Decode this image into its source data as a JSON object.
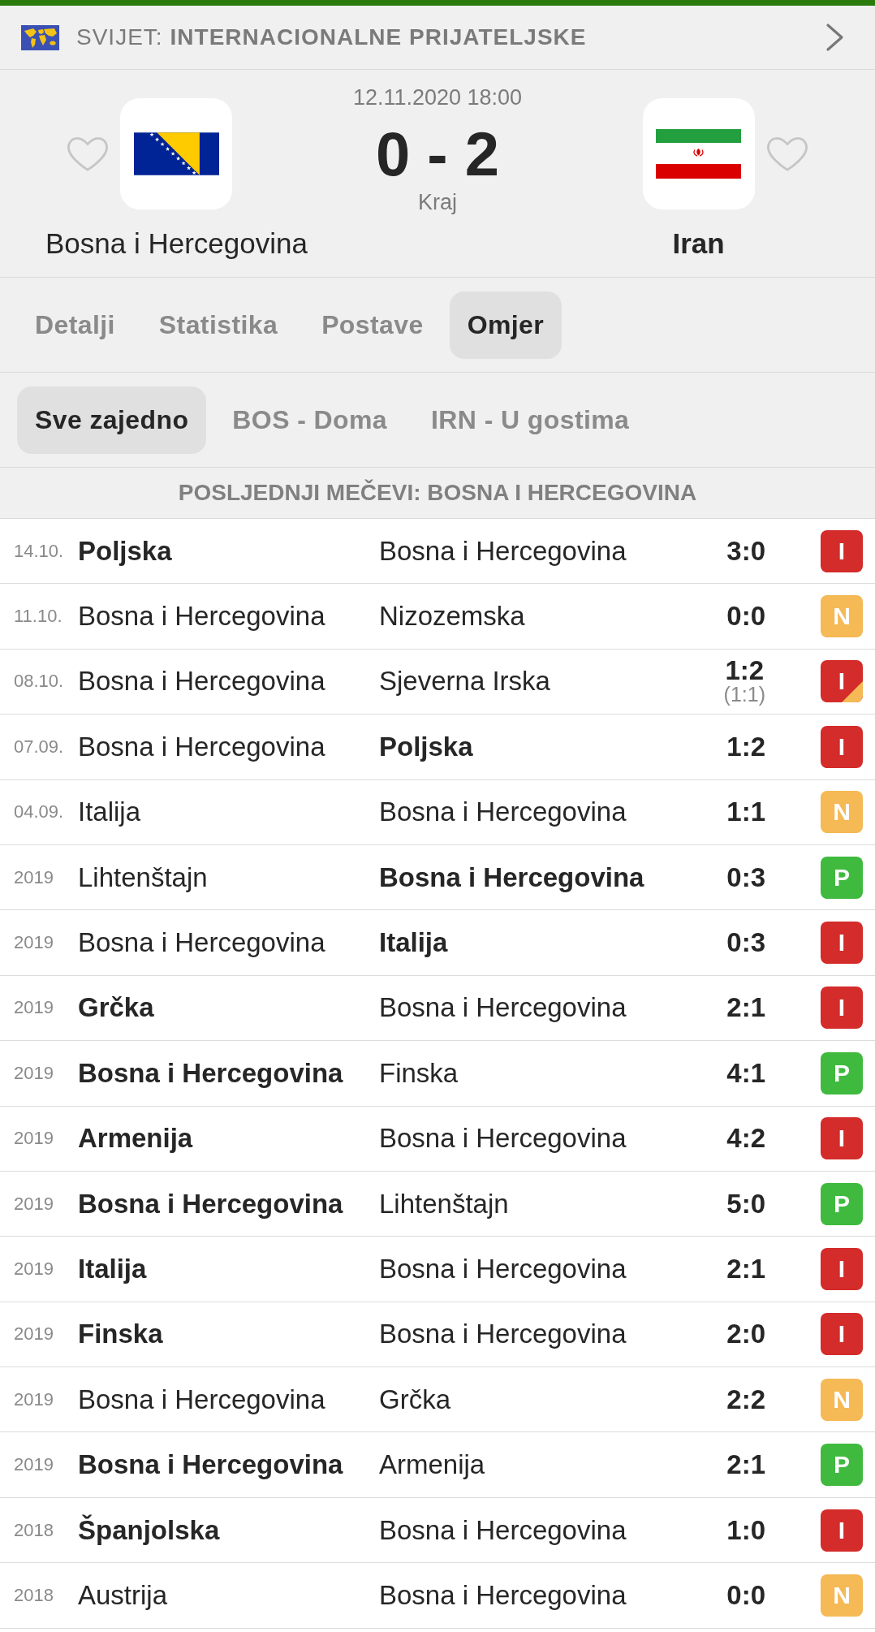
{
  "competition": {
    "country": "SVIJET:",
    "name": "INTERNACIONALNE PRIJATELJSKE"
  },
  "match": {
    "datetime": "12.11.2020 18:00",
    "score": "0 - 2",
    "status": "Kraj",
    "home": {
      "name": "Bosna i Hercegovina",
      "favorite": false,
      "winner": false
    },
    "away": {
      "name": "Iran",
      "favorite": false,
      "winner": true
    }
  },
  "tabs": [
    {
      "label": "Detalji",
      "selected": false
    },
    {
      "label": "Statistika",
      "selected": false
    },
    {
      "label": "Postave",
      "selected": false
    },
    {
      "label": "Omjer",
      "selected": true
    }
  ],
  "filters": [
    {
      "label": "Sve zajedno",
      "selected": true
    },
    {
      "label": "BOS - Doma",
      "selected": false
    },
    {
      "label": "IRN - U gostima",
      "selected": false
    }
  ],
  "section": {
    "title": "POSLJEDNJI MEČEVI: BOSNA I HERCEGOVINA"
  },
  "rows": [
    {
      "date": "14.10.",
      "home": {
        "name": "Poljska",
        "winner": true
      },
      "away": {
        "name": "Bosna i Hercegovina",
        "winner": false
      },
      "score": "3:0",
      "result": "I",
      "color": "#d42b2b",
      "penalties": false
    },
    {
      "date": "11.10.",
      "home": {
        "name": "Bosna i Hercegovina",
        "winner": false
      },
      "away": {
        "name": "Nizozemska",
        "winner": false
      },
      "score": "0:0",
      "result": "N",
      "color": "#f5b955",
      "penalties": false
    },
    {
      "date": "08.10.",
      "home": {
        "name": "Bosna i Hercegovina",
        "winner": false
      },
      "away": {
        "name": "Sjeverna Irska",
        "winner": false
      },
      "score": "1:2",
      "score_detail": "(1:1)",
      "result": "I",
      "color": "#d42b2b",
      "penalties": true
    },
    {
      "date": "07.09.",
      "home": {
        "name": "Bosna i Hercegovina",
        "winner": false
      },
      "away": {
        "name": "Poljska",
        "winner": true
      },
      "score": "1:2",
      "result": "I",
      "color": "#d42b2b",
      "penalties": false
    },
    {
      "date": "04.09.",
      "home": {
        "name": "Italija",
        "winner": false
      },
      "away": {
        "name": "Bosna i Hercegovina",
        "winner": false
      },
      "score": "1:1",
      "result": "N",
      "color": "#f5b955",
      "penalties": false
    },
    {
      "date": "2019",
      "home": {
        "name": "Lihtenštajn",
        "winner": false
      },
      "away": {
        "name": "Bosna i Hercegovina",
        "winner": true
      },
      "score": "0:3",
      "result": "P",
      "color": "#3fba3f",
      "penalties": false
    },
    {
      "date": "2019",
      "home": {
        "name": "Bosna i Hercegovina",
        "winner": false
      },
      "away": {
        "name": "Italija",
        "winner": true
      },
      "score": "0:3",
      "result": "I",
      "color": "#d42b2b",
      "penalties": false
    },
    {
      "date": "2019",
      "home": {
        "name": "Grčka",
        "winner": true
      },
      "away": {
        "name": "Bosna i Hercegovina",
        "winner": false
      },
      "score": "2:1",
      "result": "I",
      "color": "#d42b2b",
      "penalties": false
    },
    {
      "date": "2019",
      "home": {
        "name": "Bosna i Hercegovina",
        "winner": true
      },
      "away": {
        "name": "Finska",
        "winner": false
      },
      "score": "4:1",
      "result": "P",
      "color": "#3fba3f",
      "penalties": false
    },
    {
      "date": "2019",
      "home": {
        "name": "Armenija",
        "winner": true
      },
      "away": {
        "name": "Bosna i Hercegovina",
        "winner": false
      },
      "score": "4:2",
      "result": "I",
      "color": "#d42b2b",
      "penalties": false
    },
    {
      "date": "2019",
      "home": {
        "name": "Bosna i Hercegovina",
        "winner": true
      },
      "away": {
        "name": "Lihtenštajn",
        "winner": false
      },
      "score": "5:0",
      "result": "P",
      "color": "#3fba3f",
      "penalties": false
    },
    {
      "date": "2019",
      "home": {
        "name": "Italija",
        "winner": true
      },
      "away": {
        "name": "Bosna i Hercegovina",
        "winner": false
      },
      "score": "2:1",
      "result": "I",
      "color": "#d42b2b",
      "penalties": false
    },
    {
      "date": "2019",
      "home": {
        "name": "Finska",
        "winner": true
      },
      "away": {
        "name": "Bosna i Hercegovina",
        "winner": false
      },
      "score": "2:0",
      "result": "I",
      "color": "#d42b2b",
      "penalties": false
    },
    {
      "date": "2019",
      "home": {
        "name": "Bosna i Hercegovina",
        "winner": false
      },
      "away": {
        "name": "Grčka",
        "winner": false
      },
      "score": "2:2",
      "result": "N",
      "color": "#f5b955",
      "penalties": false
    },
    {
      "date": "2019",
      "home": {
        "name": "Bosna i Hercegovina",
        "winner": true
      },
      "away": {
        "name": "Armenija",
        "winner": false
      },
      "score": "2:1",
      "result": "P",
      "color": "#3fba3f",
      "penalties": false
    },
    {
      "date": "2018",
      "home": {
        "name": "Španjolska",
        "winner": true
      },
      "away": {
        "name": "Bosna i Hercegovina",
        "winner": false
      },
      "score": "1:0",
      "result": "I",
      "color": "#d42b2b",
      "penalties": false
    },
    {
      "date": "2018",
      "home": {
        "name": "Austrija",
        "winner": false
      },
      "away": {
        "name": "Bosna i Hercegovina",
        "winner": false
      },
      "score": "0:0",
      "result": "N",
      "color": "#f5b955",
      "penalties": false
    }
  ]
}
